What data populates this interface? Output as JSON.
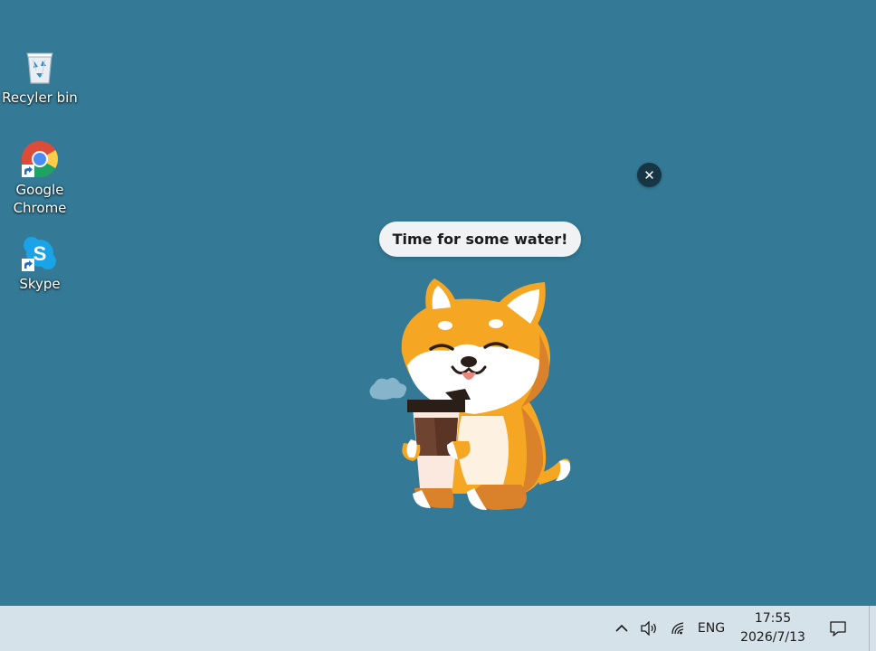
{
  "colors": {
    "desktop_bg": "#347a96",
    "taskbar_bg": "#d6e2ea",
    "bubble_bg": "#f0f2f4",
    "bubble_text": "#1b1b1b",
    "close_bg": "#163646",
    "close_fg": "#ffffff",
    "pet_orange": "#f5a623",
    "pet_dark_orange": "#d9822b",
    "pet_cream": "#ffffff",
    "cup_brown": "#6e4330"
  },
  "desktop": {
    "icons": [
      {
        "label": "Recyler bin",
        "icon": "recycle-bin-icon"
      },
      {
        "label": "Google Chrome",
        "icon": "chrome-icon"
      },
      {
        "label": "Skype",
        "icon": "skype-icon"
      }
    ]
  },
  "pet_widget": {
    "message": "Time for some water!",
    "close_symbol": "✕",
    "pet_icon": "shiba-dog-holding-coffee-cup"
  },
  "taskbar": {
    "tray": {
      "overflow_icon": "chevron-up-icon",
      "volume_icon": "speaker-icon",
      "network_icon": "wifi-icon",
      "language": "ENG",
      "time": "17:55",
      "date": "2026/7/13",
      "notification_icon": "action-center-icon"
    }
  }
}
